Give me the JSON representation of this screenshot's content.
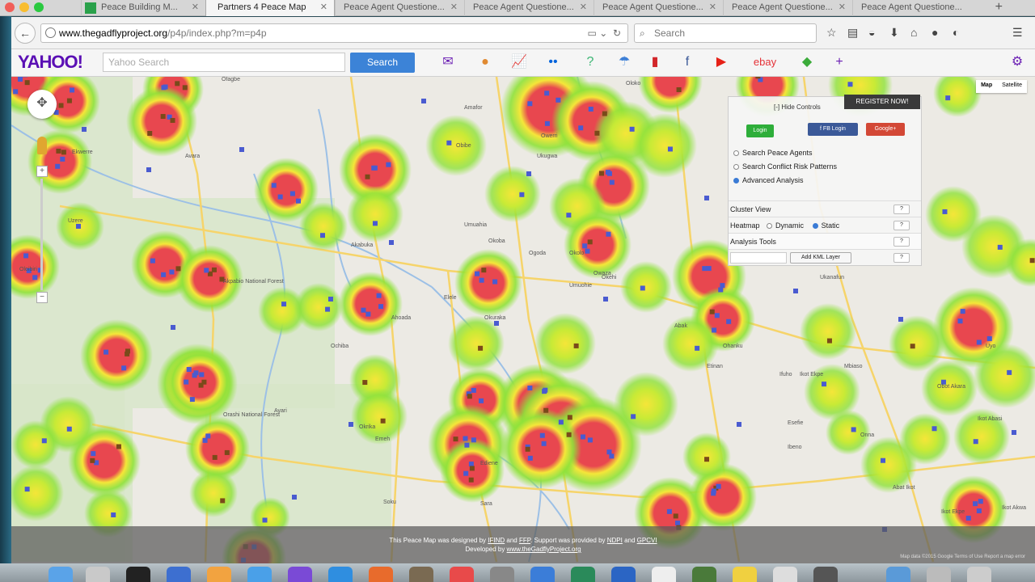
{
  "browser": {
    "tabs": [
      {
        "label": "Peace Building M...",
        "active": false
      },
      {
        "label": "Partners 4 Peace Map",
        "active": true
      },
      {
        "label": "Peace Agent Questione...",
        "active": false
      },
      {
        "label": "Peace Agent Questione...",
        "active": false
      },
      {
        "label": "Peace Agent Questione...",
        "active": false
      },
      {
        "label": "Peace Agent Questione...",
        "active": false
      },
      {
        "label": "Peace Agent Questione...",
        "active": false
      }
    ],
    "new_tab": "+",
    "url_host": "www.thegadflyproject.org",
    "url_path": "/p4p/index.php?m=p4p",
    "search_placeholder": "Search"
  },
  "yahoo": {
    "logo": "YAHOO!",
    "search_placeholder": "Yahoo Search",
    "search_button": "Search"
  },
  "map": {
    "type_map": "Map",
    "type_satellite": "Satellite",
    "labels": [
      {
        "text": "Ofagbe"
      },
      {
        "text": "Amafor"
      },
      {
        "text": "Owerri"
      },
      {
        "text": "Oloko"
      },
      {
        "text": "Avara"
      },
      {
        "text": "Ekwerre"
      },
      {
        "text": "Obibe"
      },
      {
        "text": "Ukugwa"
      },
      {
        "text": "Uzere"
      },
      {
        "text": "Umuahia"
      },
      {
        "text": "Akabuka"
      },
      {
        "text": "Okoba"
      },
      {
        "text": "Ogoda"
      },
      {
        "text": "Okolo"
      },
      {
        "text": "Owaza"
      },
      {
        "text": "Oloibiri"
      },
      {
        "text": "Elele"
      },
      {
        "text": "Okuraka"
      },
      {
        "text": "Umuohie"
      },
      {
        "text": "Abak"
      },
      {
        "text": "Okehi"
      },
      {
        "text": "Ochiba"
      },
      {
        "text": "Ahoada"
      },
      {
        "text": "Ukanafun"
      },
      {
        "text": "Ohanku"
      },
      {
        "text": "Ifuho"
      },
      {
        "text": "Ikot Ekpe"
      },
      {
        "text": "Etinan"
      },
      {
        "text": "Ayari"
      },
      {
        "text": "Okrika"
      },
      {
        "text": "Emeh"
      },
      {
        "text": "Ediene"
      },
      {
        "text": "Ibeno"
      },
      {
        "text": "Esefie"
      },
      {
        "text": "Soku"
      },
      {
        "text": "Sara"
      },
      {
        "text": "Abat Ikot"
      },
      {
        "text": "Ikot Abasi"
      },
      {
        "text": "Obot Akara"
      },
      {
        "text": "Uyo"
      },
      {
        "text": "Mbiaso"
      },
      {
        "text": "Onna"
      },
      {
        "text": "Ikot Ekpe"
      },
      {
        "text": "Ikot Akwa"
      }
    ],
    "forest_label": "Orashi National Forest",
    "forest_label_2": "Akpabio National Forest"
  },
  "panel": {
    "hide_controls": "[-] Hide Controls",
    "register": "REGISTER NOW!",
    "login": "Login",
    "fb_login": "FB Login",
    "google": "Google+",
    "options": [
      {
        "label": "Search Peace Agents",
        "selected": false
      },
      {
        "label": "Search Conflict Risk Patterns",
        "selected": false
      },
      {
        "label": "Advanced Analysis",
        "selected": true
      }
    ],
    "cluster_view": "Cluster View",
    "heatmap": "Heatmap",
    "dynamic": "Dynamic",
    "static": "Static",
    "heatmap_mode": "Static",
    "analysis_tools": "Analysis Tools",
    "add_kml": "Add KML Layer",
    "help": "?"
  },
  "footer": {
    "line1_a": "This Peace Map was designed by ",
    "line1_ifind": "IFIND",
    "line1_and": " and ",
    "line1_ffp": "FFP",
    "line1_b": ". Support was provided by ",
    "line1_ndpi": "NDPI",
    "line1_c": " and ",
    "line1_gpcvi": "GPCVI",
    "line2_a": "Developed by ",
    "line2_site": "www.theGadflyProject.org",
    "attribution": "Map data ©2015 Google   Terms of Use   Report a map error"
  },
  "colors": {
    "heat_core": "#e8474f",
    "heat_mid": "#f5e639",
    "heat_outer": "#8fe23a",
    "marker_blue": "#4a5bd0",
    "marker_brown": "#7a4a1a"
  }
}
